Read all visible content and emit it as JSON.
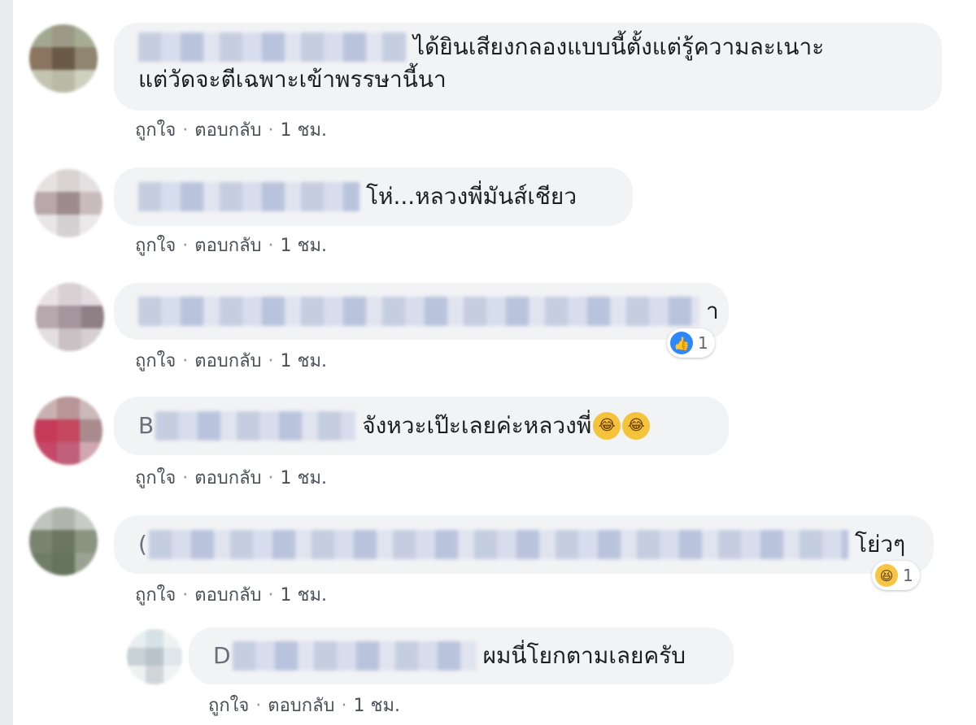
{
  "comments": [
    {
      "text": "ได้ยินเสียงกลองแบบนี้ตั้งแต่รู้ความละเนาะ",
      "text2": "แต่วัดจะตีเฉพาะเข้าพรรษานี้นา",
      "actions": {
        "like": "ถูกใจ",
        "reply": "ตอบกลับ",
        "time": "1 ชม."
      },
      "avatar_colors": [
        "#a3a890",
        "#9c9a86",
        "#a6ad93",
        "#8a7560",
        "#6a5a45",
        "#8f8570",
        "#c3c5b2",
        "#b9bba7",
        "#cfd1c0"
      ]
    },
    {
      "text": "โห่...หลวงพี่มันส์เชียว",
      "actions": {
        "like": "ถูกใจ",
        "reply": "ตอบกลับ",
        "time": "1 ชม."
      },
      "avatar_colors": [
        "#e6e2e2",
        "#d9d3d4",
        "#e4e0e1",
        "#b8a8ab",
        "#9d8b8e",
        "#c9bcbe",
        "#e8e6e6",
        "#d5d1d2",
        "#eae8e8"
      ]
    },
    {
      "text": "า",
      "actions": {
        "like": "ถูกใจ",
        "reply": "ตอบกลับ",
        "time": "1 ชม."
      },
      "reaction": {
        "icon": "like-icon",
        "count": "1",
        "color": "#2d88ff"
      },
      "avatar_colors": [
        "#e7e2e4",
        "#d8d0d3",
        "#e3dde0",
        "#b6a8ad",
        "#a5959c",
        "#8f8086",
        "#e3dfe0",
        "#c9c1c4",
        "#d6d0d2"
      ]
    },
    {
      "lead": "B",
      "text": "จังหวะเป๊ะเลยค่ะหลวงพี่",
      "emojis": [
        "😂",
        "😂"
      ],
      "actions": {
        "like": "ถูกใจ",
        "reply": "ตอบกลับ",
        "time": "1 ชม."
      },
      "avatar_colors": [
        "#c9b1b1",
        "#b89596",
        "#ccb9b9",
        "#c43a58",
        "#c5485f",
        "#a98b8e",
        "#c74768",
        "#c0607a",
        "#d2a7b1"
      ]
    },
    {
      "lead": "(",
      "text": "โย่วๆ",
      "actions": {
        "like": "ถูกใจ",
        "reply": "ตอบกลับ",
        "time": "1 ชม."
      },
      "reaction": {
        "icon": "haha-icon",
        "count": "1",
        "color": "#f7c543"
      },
      "avatar_colors": [
        "#c0c4be",
        "#b1b6ad",
        "#c7cbc4",
        "#7a8570",
        "#6b7760",
        "#8a9481",
        "#6f7c66",
        "#66735d",
        "#9aa292"
      ]
    }
  ],
  "reply": {
    "lead": "D",
    "text": "ผมนี่โยกตามเลยครับ",
    "actions": {
      "like": "ถูกใจ",
      "reply": "ตอบกลับ",
      "time": "1 ชม."
    },
    "avatar_colors": [
      "#e9eef0",
      "#d7e2e6",
      "#eef2f3",
      "#c8d1d6",
      "#b9c4ca",
      "#dfe6e9",
      "#eef1f2",
      "#cfd6da",
      "#f0f3f4"
    ]
  },
  "ui": {
    "separator": "·"
  }
}
